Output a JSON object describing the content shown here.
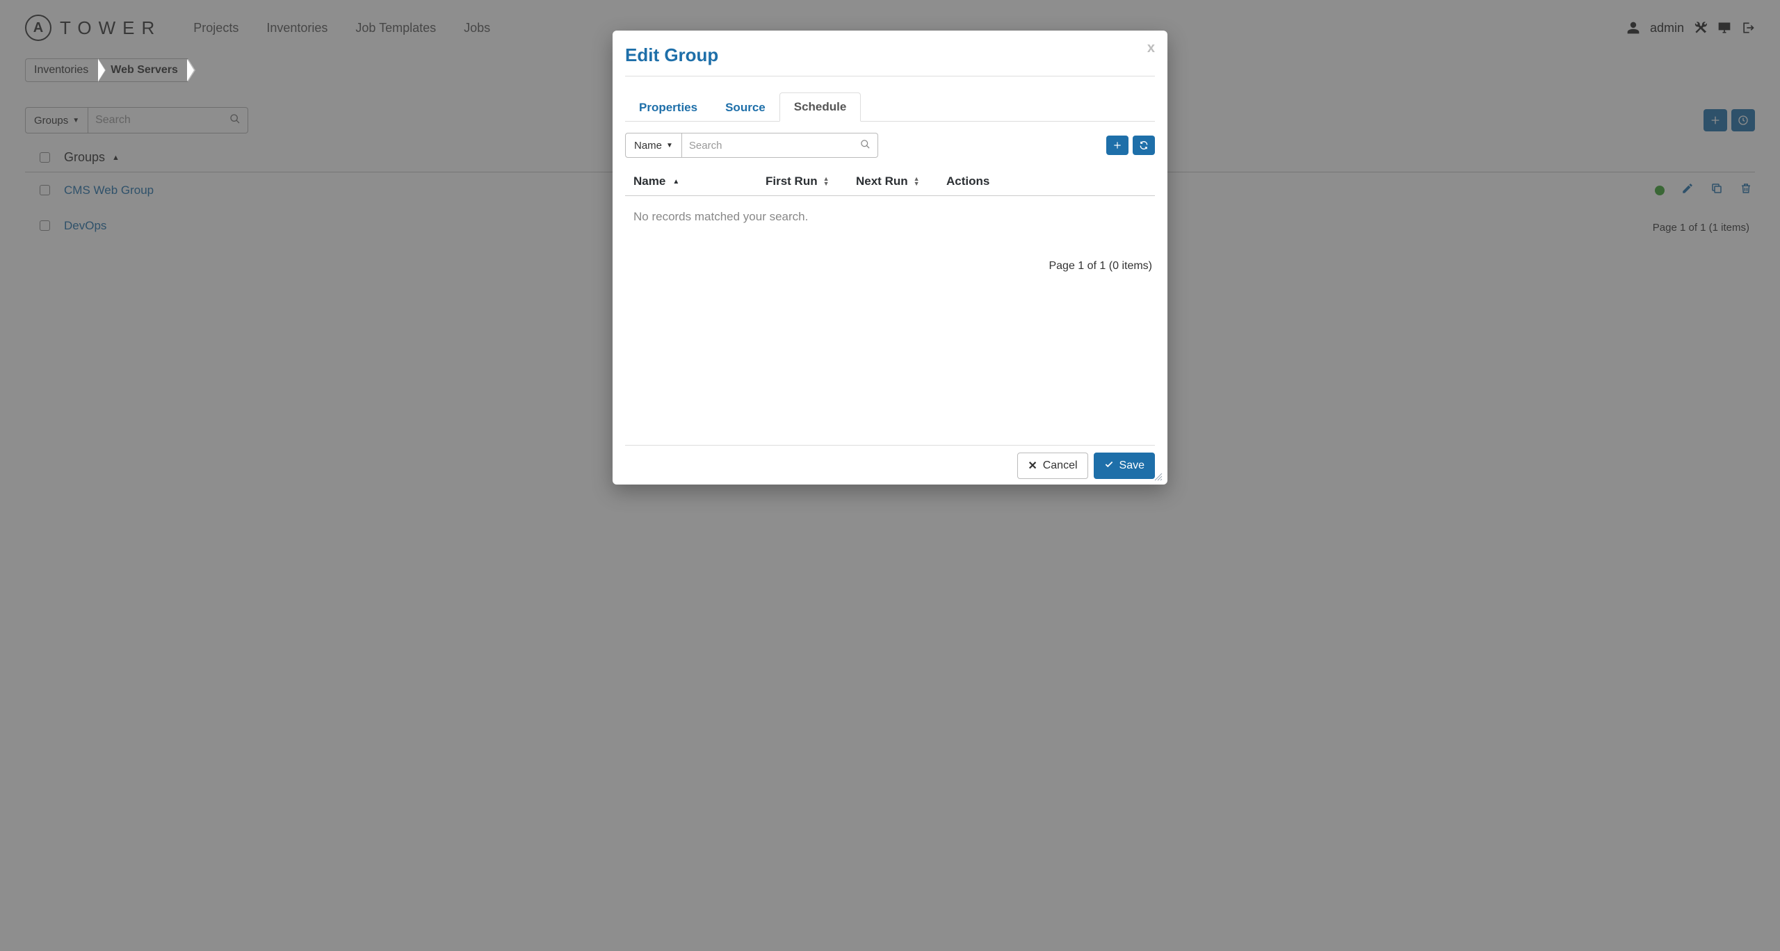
{
  "brand": {
    "logo_letter": "A",
    "name": "TOWER"
  },
  "nav": {
    "projects": "Projects",
    "inventories": "Inventories",
    "job_templates": "Job Templates",
    "jobs": "Jobs"
  },
  "user": {
    "name": "admin"
  },
  "breadcrumb": {
    "root": "Inventories",
    "current": "Web Servers"
  },
  "groups_panel": {
    "dropdown_label": "Groups",
    "search_placeholder": "Search",
    "header_groups": "Groups",
    "rows": [
      {
        "name": "CMS Web Group"
      },
      {
        "name": "DevOps"
      }
    ],
    "pager": "Page 1 of 1 (1 items)"
  },
  "modal": {
    "title": "Edit Group",
    "tabs": {
      "properties": "Properties",
      "source": "Source",
      "schedule": "Schedule"
    },
    "toolbar": {
      "dropdown_label": "Name",
      "search_placeholder": "Search"
    },
    "columns": {
      "name": "Name",
      "first_run": "First Run",
      "next_run": "Next Run",
      "actions": "Actions"
    },
    "empty": "No records matched your search.",
    "pager": "Page 1 of 1 (0 items)",
    "buttons": {
      "cancel": "Cancel",
      "save": "Save"
    }
  }
}
